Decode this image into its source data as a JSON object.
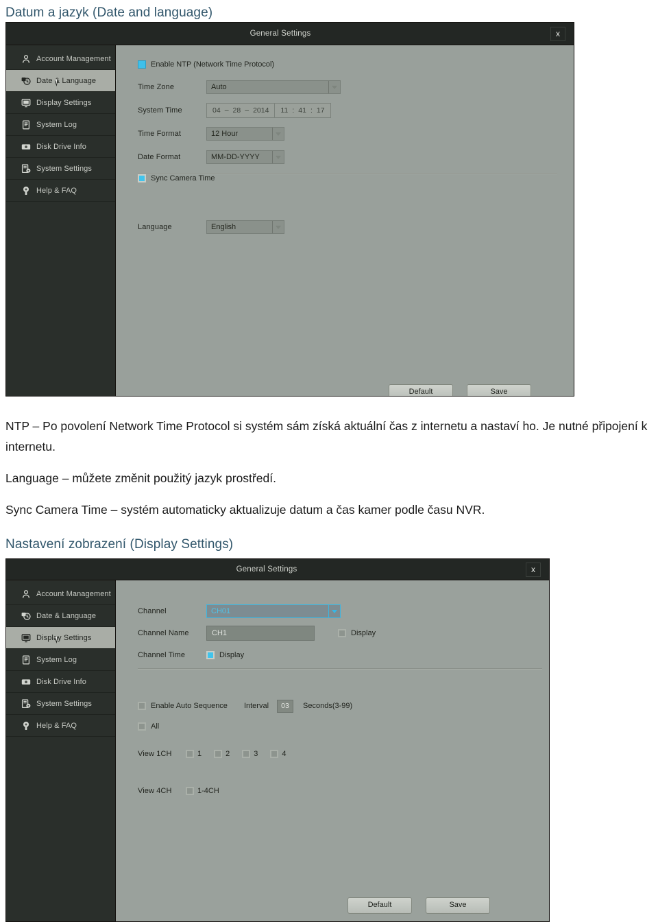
{
  "document": {
    "heading_date_language": "Datum a jazyk (Date and language)",
    "heading_display_settings": "Nastavení zobrazení (Display Settings)",
    "paragraphs": [
      "NTP – Po povolení Network Time Protocol si systém sám získá aktuální čas z internetu a nastaví ho. Je nutné připojení k internetu.",
      "Language – můžete změnit použitý jazyk prostředí.",
      "Sync Camera Time – systém automaticky aktualizuje datum a čas kamer podle času NVR."
    ],
    "heading_color": "#31566b"
  },
  "sidebar": {
    "items": [
      {
        "label": "Account Management",
        "icon": "user-icon"
      },
      {
        "label": "Date & Language",
        "icon": "clock-icon"
      },
      {
        "label": "Display Settings",
        "icon": "monitor-icon"
      },
      {
        "label": "System Log",
        "icon": "log-icon"
      },
      {
        "label": "Disk Drive Info",
        "icon": "disk-icon"
      },
      {
        "label": "System Settings",
        "icon": "system-gear-icon"
      },
      {
        "label": "Help & FAQ",
        "icon": "help-bulb-icon"
      }
    ]
  },
  "dialog1": {
    "title": "General Settings",
    "close_label": "x",
    "active_sidebar_index": 1,
    "enable_ntp_label": "Enable NTP (Network Time Protocol)",
    "enable_ntp_checked": "on",
    "time_zone_label": "Time Zone",
    "time_zone_value": "Auto",
    "system_time_label": "System Time",
    "system_time_month": "04",
    "system_time_sep1": "–",
    "system_time_day": "28",
    "system_time_sep2": "–",
    "system_time_year": "2014",
    "system_time_hour": "11",
    "system_time_colon1": ":",
    "system_time_minute": "41",
    "system_time_colon2": ":",
    "system_time_second": "17",
    "time_format_label": "Time Format",
    "time_format_value": "12 Hour",
    "date_format_label": "Date Format",
    "date_format_value": "MM-DD-YYYY",
    "sync_camera_time_label": "Sync Camera Time",
    "sync_camera_time_checked": "on",
    "language_label": "Language",
    "language_value": "English",
    "default_button": "Default",
    "save_button": "Save"
  },
  "dialog2": {
    "title": "General Settings",
    "close_label": "x",
    "active_sidebar_index": 2,
    "channel_label": "Channel",
    "channel_value": "CH01",
    "channel_name_label": "Channel Name",
    "channel_name_value": "CH1",
    "channel_name_display_label": "Display",
    "channel_name_display_checked": "off",
    "channel_time_label": "Channel Time",
    "channel_time_display_label": "Display",
    "channel_time_display_checked": "on",
    "enable_auto_sequence_label": "Enable Auto Sequence",
    "enable_auto_sequence_checked": "off",
    "interval_label": "Interval",
    "interval_value": "03",
    "interval_units": "Seconds(3-99)",
    "all_label": "All",
    "all_checked": "off",
    "view_1ch_label": "View 1CH",
    "view_1ch_options": [
      "1",
      "2",
      "3",
      "4"
    ],
    "view_4ch_label": "View 4CH",
    "view_4ch_option": "1-4CH",
    "default_button": "Default",
    "save_button": "Save"
  }
}
